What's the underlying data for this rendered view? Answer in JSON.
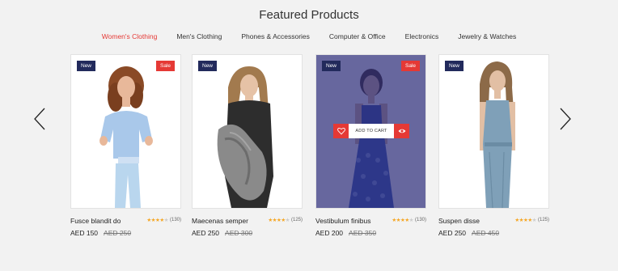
{
  "title": "Featured Products",
  "tabs": [
    {
      "label": "Women's Clothing",
      "active": true
    },
    {
      "label": "Men's Clothing",
      "active": false
    },
    {
      "label": "Phones & Accessories",
      "active": false
    },
    {
      "label": "Computer & Office",
      "active": false
    },
    {
      "label": "Electronics",
      "active": false
    },
    {
      "label": "Jewelry & Watches",
      "active": false
    }
  ],
  "colors": {
    "accent": "#e53935",
    "badge_new": "#222a5c",
    "hover_overlay": "#2c2c78",
    "star": "#f5a623"
  },
  "nav": {
    "prev_icon": "chevron-left-icon",
    "next_icon": "chevron-right-icon"
  },
  "products": [
    {
      "name": "Fusce blandit do",
      "rating": 4,
      "reviews": "(130)",
      "price": "AED 150",
      "old_price": "AED 250",
      "badge_new": "New",
      "badge_sale": "Sale",
      "hovered": false
    },
    {
      "name": "Maecenas semper",
      "rating": 4,
      "reviews": "(125)",
      "price": "AED 250",
      "old_price": "AED 300",
      "badge_new": "New",
      "badge_sale": "",
      "hovered": false
    },
    {
      "name": "Vestibulum finibus",
      "rating": 4,
      "reviews": "(130)",
      "price": "AED 200",
      "old_price": "AED 350",
      "badge_new": "New",
      "badge_sale": "Sale",
      "hovered": true
    },
    {
      "name": "Suspen disse",
      "rating": 4,
      "reviews": "(125)",
      "price": "AED 250",
      "old_price": "AED 450",
      "badge_new": "New",
      "badge_sale": "",
      "hovered": false
    }
  ],
  "hover_actions": {
    "add_to_cart": "ADD TO CART",
    "wishlist_icon": "heart-icon",
    "quickview_icon": "eye-icon"
  }
}
